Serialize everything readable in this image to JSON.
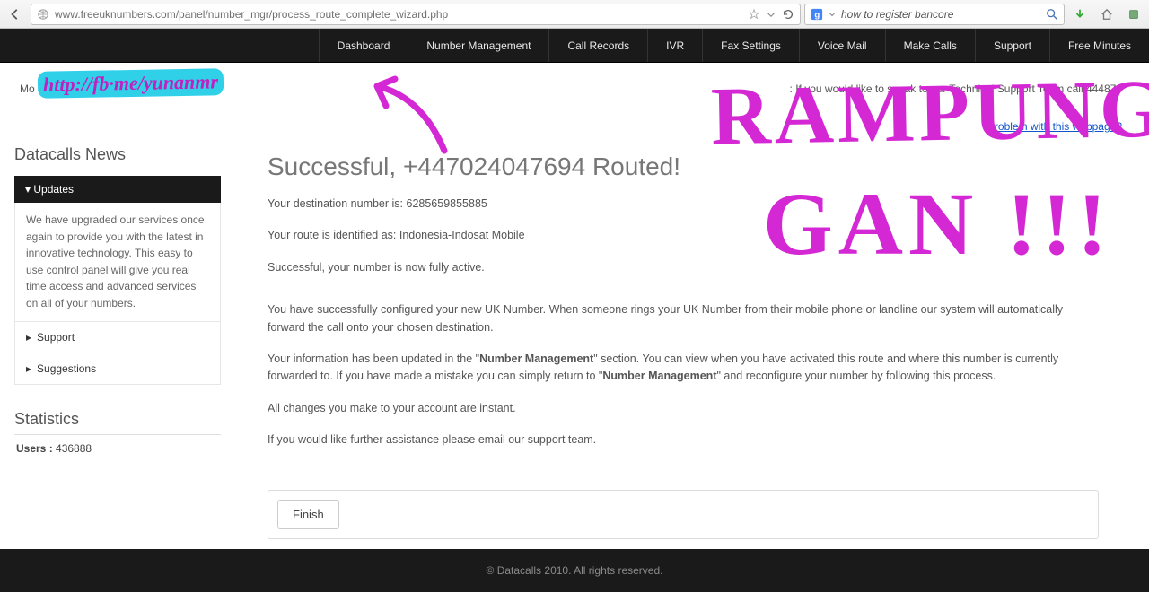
{
  "browser": {
    "url": "www.freeuknumbers.com/panel/number_mgr/process_route_complete_wizard.php",
    "search": "how to register bancore"
  },
  "nav": {
    "items": [
      "Dashboard",
      "Number Management",
      "Call Records",
      "IVR",
      "Fax Settings",
      "Voice Mail",
      "Make Calls",
      "Support",
      "Free Minutes"
    ]
  },
  "top": {
    "left_prefix": "Mo",
    "right_msg": ": If you would like to speak to our Technical Support Team call 444870",
    "problem_link": "problem with this webpage?"
  },
  "sidebar": {
    "news_title": "Datacalls News",
    "updates_header": "Updates",
    "news_body": "We have upgraded our services once again to provide you with the latest in innovative technology. This easy to use control panel will give you real time access and advanced services on all of your numbers.",
    "acc_support": "Support",
    "acc_suggestions": "Suggestions",
    "stats_title": "Statistics",
    "stats_label": "Users :",
    "stats_value": "436888"
  },
  "main": {
    "heading": "Successful, +447024047694 Routed!",
    "p1": "Your destination number is: 6285659855885",
    "p2": "Your route is identified as: Indonesia-Indosat Mobile",
    "p3": "Successful, your number is now fully active.",
    "p4": "You have successfully configured your new UK Number. When someone rings your UK Number from their mobile phone or landline our system will automatically forward the call onto your chosen destination.",
    "p5a": "Your information has been updated in the \"",
    "p5b": "Number Management",
    "p5c": "\" section. You can view when you have activated this route and where this number is currently forwarded to. If you have made a mistake you can simply return to \"",
    "p5d": "Number Management",
    "p5e": "\" and reconfigure your number by following this process.",
    "p6": "All changes you make to your account are instant.",
    "p7": "If you would like further assistance please email our support team.",
    "finish": "Finish"
  },
  "footer": {
    "text": "© Datacalls 2010. All rights reserved."
  },
  "annotations": {
    "url": "http://fb·me/yunanmr",
    "ramp": "RAMPUNG",
    "gan": "GAN !!!"
  }
}
